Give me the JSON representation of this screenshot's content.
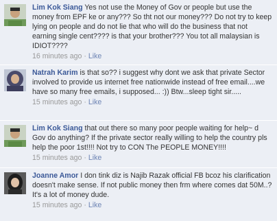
{
  "comments": [
    {
      "author": "Lim Kok Siang",
      "text": "Yes not use the Money of Gov or people but use the money from EPF ke or any??? So tht not our money??? Do not try to keep lying on people and do not lie that who will do the business that not earning single cent???? is that your brother??? You tot all malaysian is IDIOT????",
      "time": "16 minutes ago",
      "separator": "·",
      "like": "Like",
      "avatar": "avatar-photo-man-green-shirt"
    },
    {
      "author": "Natrah Karim",
      "text": "is that so?? i suggest why dont we ask that private Sector involved to provide us internet free nationwide instead of free email....we have so many free emails, i supposed... :)) Btw...sleep tight sir.....",
      "time": "15 minutes ago",
      "separator": "·",
      "like": "Like",
      "avatar": "avatar-photo-woman-headscarf"
    },
    {
      "author": "Lim Kok Siang",
      "text": "that out there so many poor people waiting for help~ d Gov do anything? If the private sector really willing to help the country pls help the poor 1st!!!! Not try to CON The PEOPLE MONEY!!!!",
      "time": "15 minutes ago",
      "separator": "·",
      "like": "Like",
      "avatar": "avatar-photo-man-green-shirt"
    },
    {
      "author": "Joanne Amor",
      "text": "I don tink diz is Najib Razak official FB bcoz his clarification doesn't make sense. If not public money then frm where comes dat 50M..? It's a lot of money dude.",
      "time": "15 minutes ago",
      "separator": "·",
      "like": "Like",
      "avatar": "avatar-photo-woman-dark-hair"
    }
  ],
  "colors": {
    "background": "#eceff5",
    "author": "#3b5998",
    "like": "#6d84b4",
    "meta": "#999999",
    "text": "#333333"
  }
}
